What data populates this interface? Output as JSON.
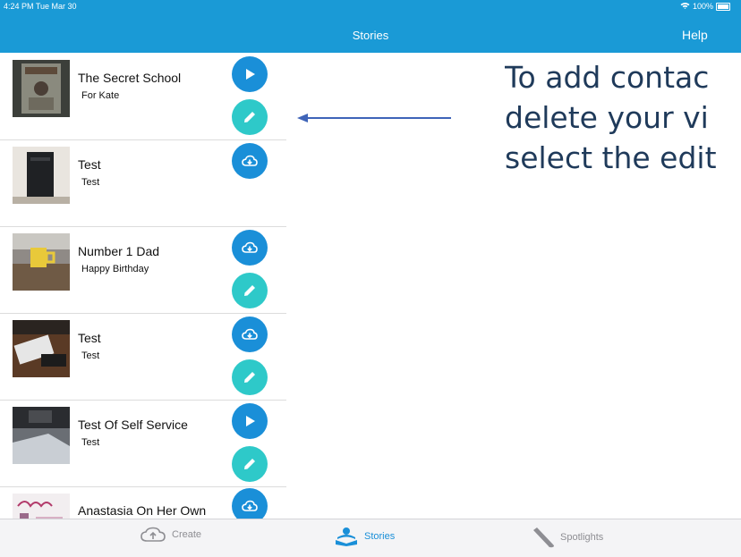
{
  "status_bar": {
    "time": "4:24 PM  Tue Mar 30",
    "battery": "100%"
  },
  "nav": {
    "title": "Stories",
    "help": "Help"
  },
  "stories": [
    {
      "title": "The Secret School",
      "subtitle": "For Kate",
      "top_action": "play",
      "has_edit": true
    },
    {
      "title": "Test",
      "subtitle": "Test",
      "top_action": "cloud",
      "has_edit": false
    },
    {
      "title": "Number 1 Dad",
      "subtitle": "Happy Birthday",
      "top_action": "cloud",
      "has_edit": true
    },
    {
      "title": "Test",
      "subtitle": "Test",
      "top_action": "cloud",
      "has_edit": true
    },
    {
      "title": "Test Of Self Service",
      "subtitle": "Test",
      "top_action": "play",
      "has_edit": true
    },
    {
      "title": "Anastasia On Her Own",
      "subtitle": "",
      "top_action": "cloud",
      "has_edit": false
    }
  ],
  "annotation": {
    "lines": [
      "To add contac",
      "delete your vi",
      "select the edit"
    ]
  },
  "tabs": [
    {
      "label": "Create",
      "icon": "cloud-upload-icon",
      "active": false
    },
    {
      "label": "Stories",
      "icon": "reader-icon",
      "active": true
    },
    {
      "label": "Spotlights",
      "icon": "spotlight-icon",
      "active": false
    }
  ],
  "colors": {
    "accent": "#1a9ad6",
    "edit": "#2ec9c9",
    "annotation": "#1f3a5a"
  }
}
